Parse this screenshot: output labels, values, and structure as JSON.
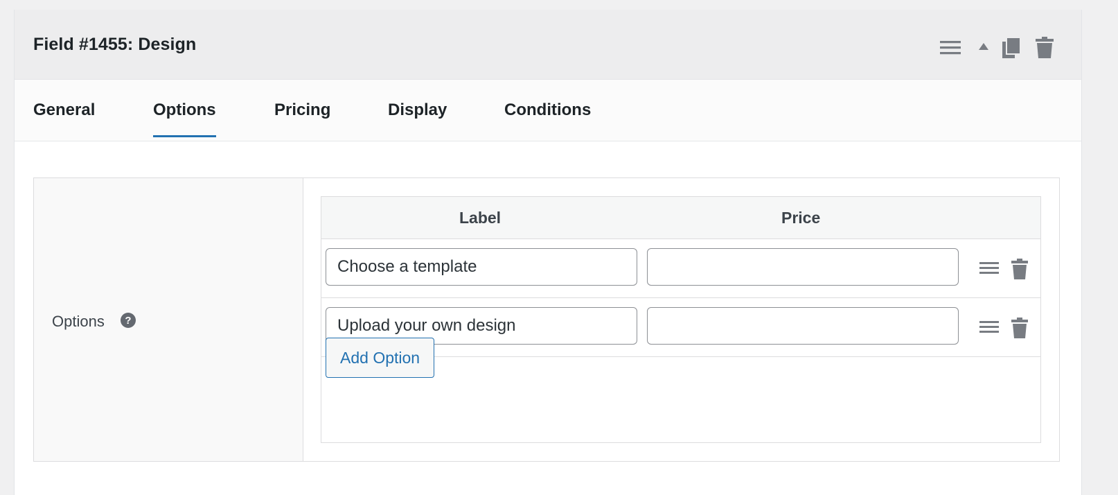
{
  "panel": {
    "title": "Field #1455: Design",
    "header_icons": [
      "menu-icon",
      "collapse-arrow-icon",
      "duplicate-icon",
      "trash-icon"
    ]
  },
  "tabs": [
    {
      "label": "General",
      "active": false
    },
    {
      "label": "Options",
      "active": true
    },
    {
      "label": "Pricing",
      "active": false
    },
    {
      "label": "Display",
      "active": false
    },
    {
      "label": "Conditions",
      "active": false
    }
  ],
  "options_section": {
    "label": "Options",
    "help_icon": "question-circle-icon",
    "columns": {
      "label": "Label",
      "price": "Price"
    },
    "rows": [
      {
        "label": "Choose a template",
        "price": ""
      },
      {
        "label": "Upload your own design",
        "price": ""
      }
    ],
    "add_button": "Add Option"
  },
  "colors": {
    "accent": "#2271b1",
    "header_bg": "#ededee",
    "icon_gray": "#787c82"
  }
}
